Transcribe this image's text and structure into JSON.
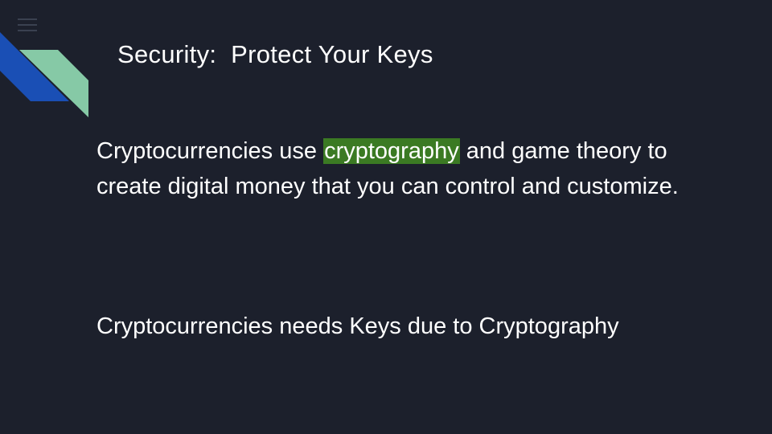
{
  "slide": {
    "title": "Security:  Protect Your Keys",
    "paragraph1": {
      "before": "Cryptocurrencies use ",
      "highlighted": "cryptography",
      "after": " and game theory to create digital money that you can control and customize."
    },
    "paragraph2": "Cryptocurrencies needs Keys due to Cryptography"
  },
  "colors": {
    "background": "#1c202c",
    "highlight": "#3b7a23",
    "accent_blue": "#1a4fb5",
    "accent_green": "#86c9a6"
  },
  "icons": {
    "menu": "hamburger-menu-icon"
  }
}
